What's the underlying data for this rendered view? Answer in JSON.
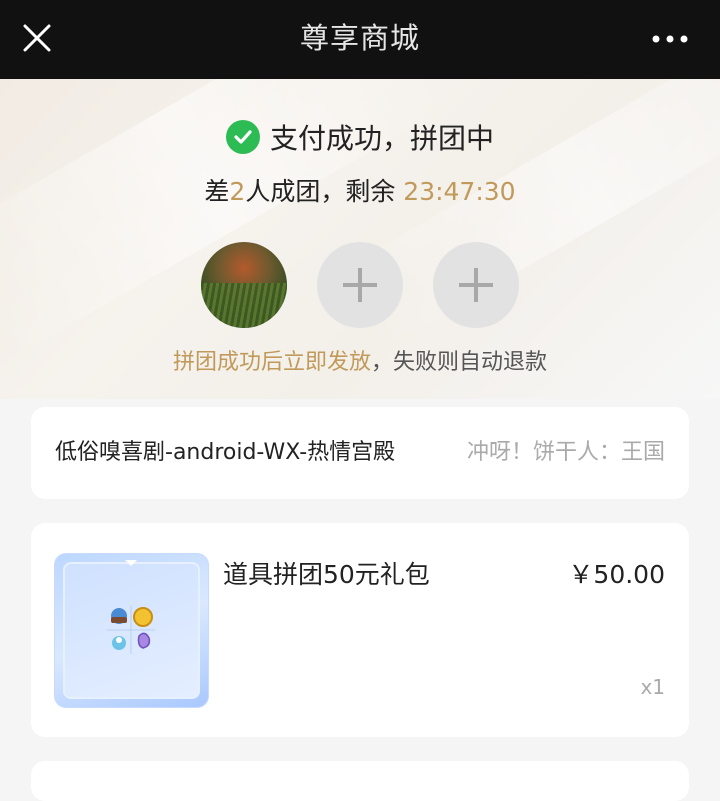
{
  "header": {
    "title": "尊享商城",
    "close_icon": "close-icon",
    "more_icon": "more-icon"
  },
  "status": {
    "icon": "check-circle-icon",
    "text": "支付成功，拼团中",
    "lack_prefix": "差",
    "lack_count": "2",
    "lack_suffix": "人成团，剩余",
    "countdown": "23:47:30",
    "note_highlight": "拼团成功后立即发放",
    "note_rest": "，失败则自动退款"
  },
  "team": {
    "members_joined": 1,
    "open_slots": 2
  },
  "game_info": {
    "game_name": "低俗嗅喜剧-android-WX-热情宫殿",
    "server_name": "冲呀！饼干人：王国"
  },
  "product": {
    "name": "道具拼团50元礼包",
    "price": "￥50.00",
    "quantity": "x1"
  },
  "colors": {
    "accent_gold": "#c19a5b",
    "success_green": "#2dbb53",
    "topbar_bg": "#111111"
  }
}
